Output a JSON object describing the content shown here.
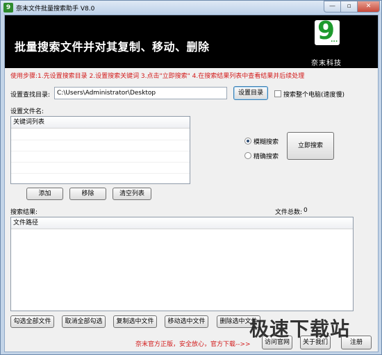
{
  "window": {
    "title": "奈末文件批量搜索助手 V8.0",
    "controls": {
      "minimize": "—",
      "maximize": "▫",
      "close": "✕"
    }
  },
  "banner": {
    "headline": "批量搜索文件并对其复制、移动、删除",
    "logo_mark": "9",
    "logo_dots": "...",
    "brand": "奈末科技"
  },
  "steps_text": "使用步骤:1.先设置搜索目录 2.设置搜索关键词 3.点击\"立即搜索\" 4.在搜索结果列表中查看结果并后续处理",
  "directory": {
    "label": "设置查找目录:",
    "value": "C:\\Users\\Administrator\\Desktop",
    "set_button": "设置目录",
    "whole_pc_checkbox": "搜索整个电脑(速度慢)"
  },
  "keywords": {
    "label": "设置文件名:",
    "column": "关键词列表",
    "buttons": {
      "add": "添加",
      "remove": "移除",
      "clear": "清空列表"
    }
  },
  "search_mode": {
    "fuzzy": "模糊搜索",
    "exact": "精确搜索",
    "search_button": "立即搜索"
  },
  "results": {
    "label": "搜索结果:",
    "count_label": "文件总数:",
    "count": "0",
    "column": "文件路径"
  },
  "actions": {
    "check_all": "勾选全部文件",
    "uncheck_all": "取消全部勾选",
    "copy": "复制选中文件",
    "move": "移动选中文件",
    "delete": "删除选中文件"
  },
  "footer": {
    "note": "奈末官方正版，安全放心，官方下载-->>",
    "visit_site": "访问官网",
    "about": "关于我们",
    "register": "注册"
  },
  "watermark_text": "极速下载站",
  "colors": {
    "accent_red": "#d21a1a",
    "banner_bg": "#000000",
    "logo_green": "#1e9a2d"
  }
}
